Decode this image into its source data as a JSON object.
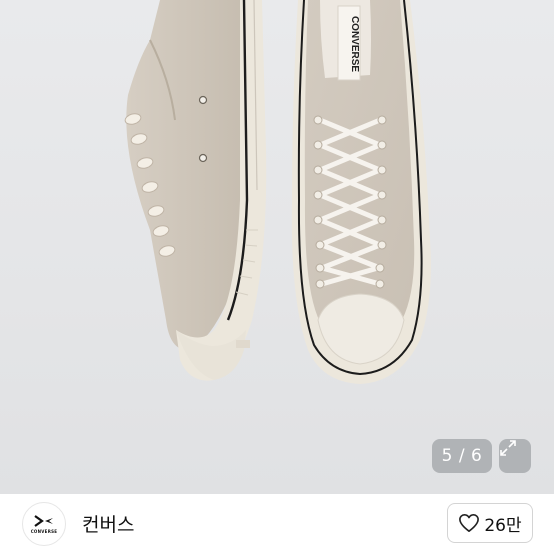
{
  "gallery": {
    "image_alt": "Converse Chuck 70 low-top sneakers in light beige canvas",
    "shoe_tongue_label": "CONVERSE",
    "counter": "5 / 6"
  },
  "brand": {
    "logo_word": "CONVERSE",
    "name": "컨버스"
  },
  "like": {
    "count": "26만"
  },
  "colors": {
    "canvas": "#cfc6ba",
    "rubber": "#ece7dc",
    "background": "#e6e7e9"
  }
}
